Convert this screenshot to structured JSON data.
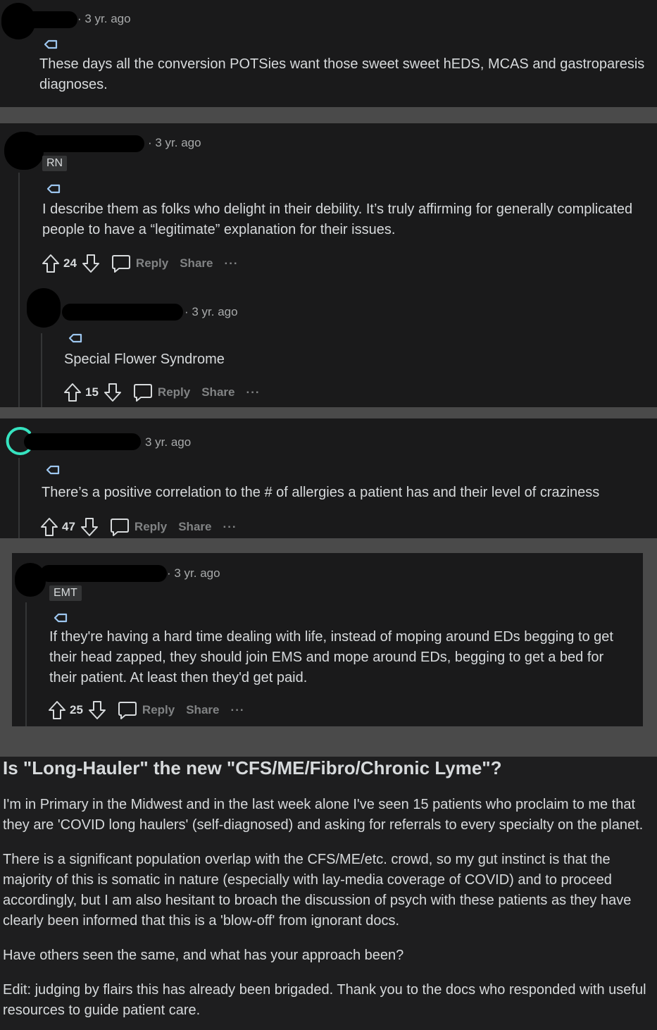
{
  "comments": [
    {
      "time": "· 3 yr. ago",
      "flair": "",
      "text": "These days all the conversion POTSies want those sweet sweet hEDS, MCAS and gastroparesis diagnoses."
    },
    {
      "time": "· 3 yr. ago",
      "flair": "RN",
      "text": "I describe them as folks who delight in their debility. It’s truly affirming for generally complicated people to have a “legitimate” explanation for their issues.",
      "votes": "24",
      "reply": "Reply",
      "share": "Share",
      "more": "..."
    },
    {
      "time": "· 3 yr. ago",
      "flair": "",
      "text": "Special Flower Syndrome",
      "votes": "15",
      "reply": "Reply",
      "share": "Share",
      "more": "..."
    },
    {
      "time": "3 yr. ago",
      "flair": "",
      "text": "There’s a positive correlation to the # of allergies a patient has and their level of craziness",
      "votes": "47",
      "reply": "Reply",
      "share": "Share",
      "more": "..."
    },
    {
      "time": "· 3 yr. ago",
      "flair": "EMT",
      "text": "If they're having a hard time dealing with life, instead of moping around EDs begging to get their head zapped, they should join EMS and mope around EDs, begging to get a bed for their patient. At least then they'd get paid.",
      "votes": "25",
      "reply": "Reply",
      "share": "Share",
      "more": "..."
    }
  ],
  "post": {
    "title": "Is \"Long-Hauler\" the new \"CFS/ME/Fibro/Chronic Lyme\"?",
    "paragraphs": [
      "I'm in Primary in the Midwest and in the last week alone I've seen 15 patients who proclaim to me that they are 'COVID long haulers' (self-diagnosed) and asking for referrals to every specialty on the planet.",
      "There is a significant population overlap with the CFS/ME/etc. crowd, so my gut instinct is that the majority of this is somatic in nature (especially with lay-media coverage of COVID) and to proceed accordingly, but I am also hesitant to broach the discussion of psych with these patients as they have clearly been informed that this is a 'blow-off' from ignorant docs.",
      "Have others seen the same, and what has your approach been?",
      "Edit: judging by flairs this has already been brigaded. Thank you to the docs who responded with useful resources to guide patient care."
    ]
  },
  "colors": {
    "background": "#1a1a1b",
    "separator": "#4a4a4a",
    "text": "#d7dadc",
    "muted": "#818384",
    "tag_icon": "#9ec7f0",
    "avatar_ring": "#36e3c0"
  }
}
